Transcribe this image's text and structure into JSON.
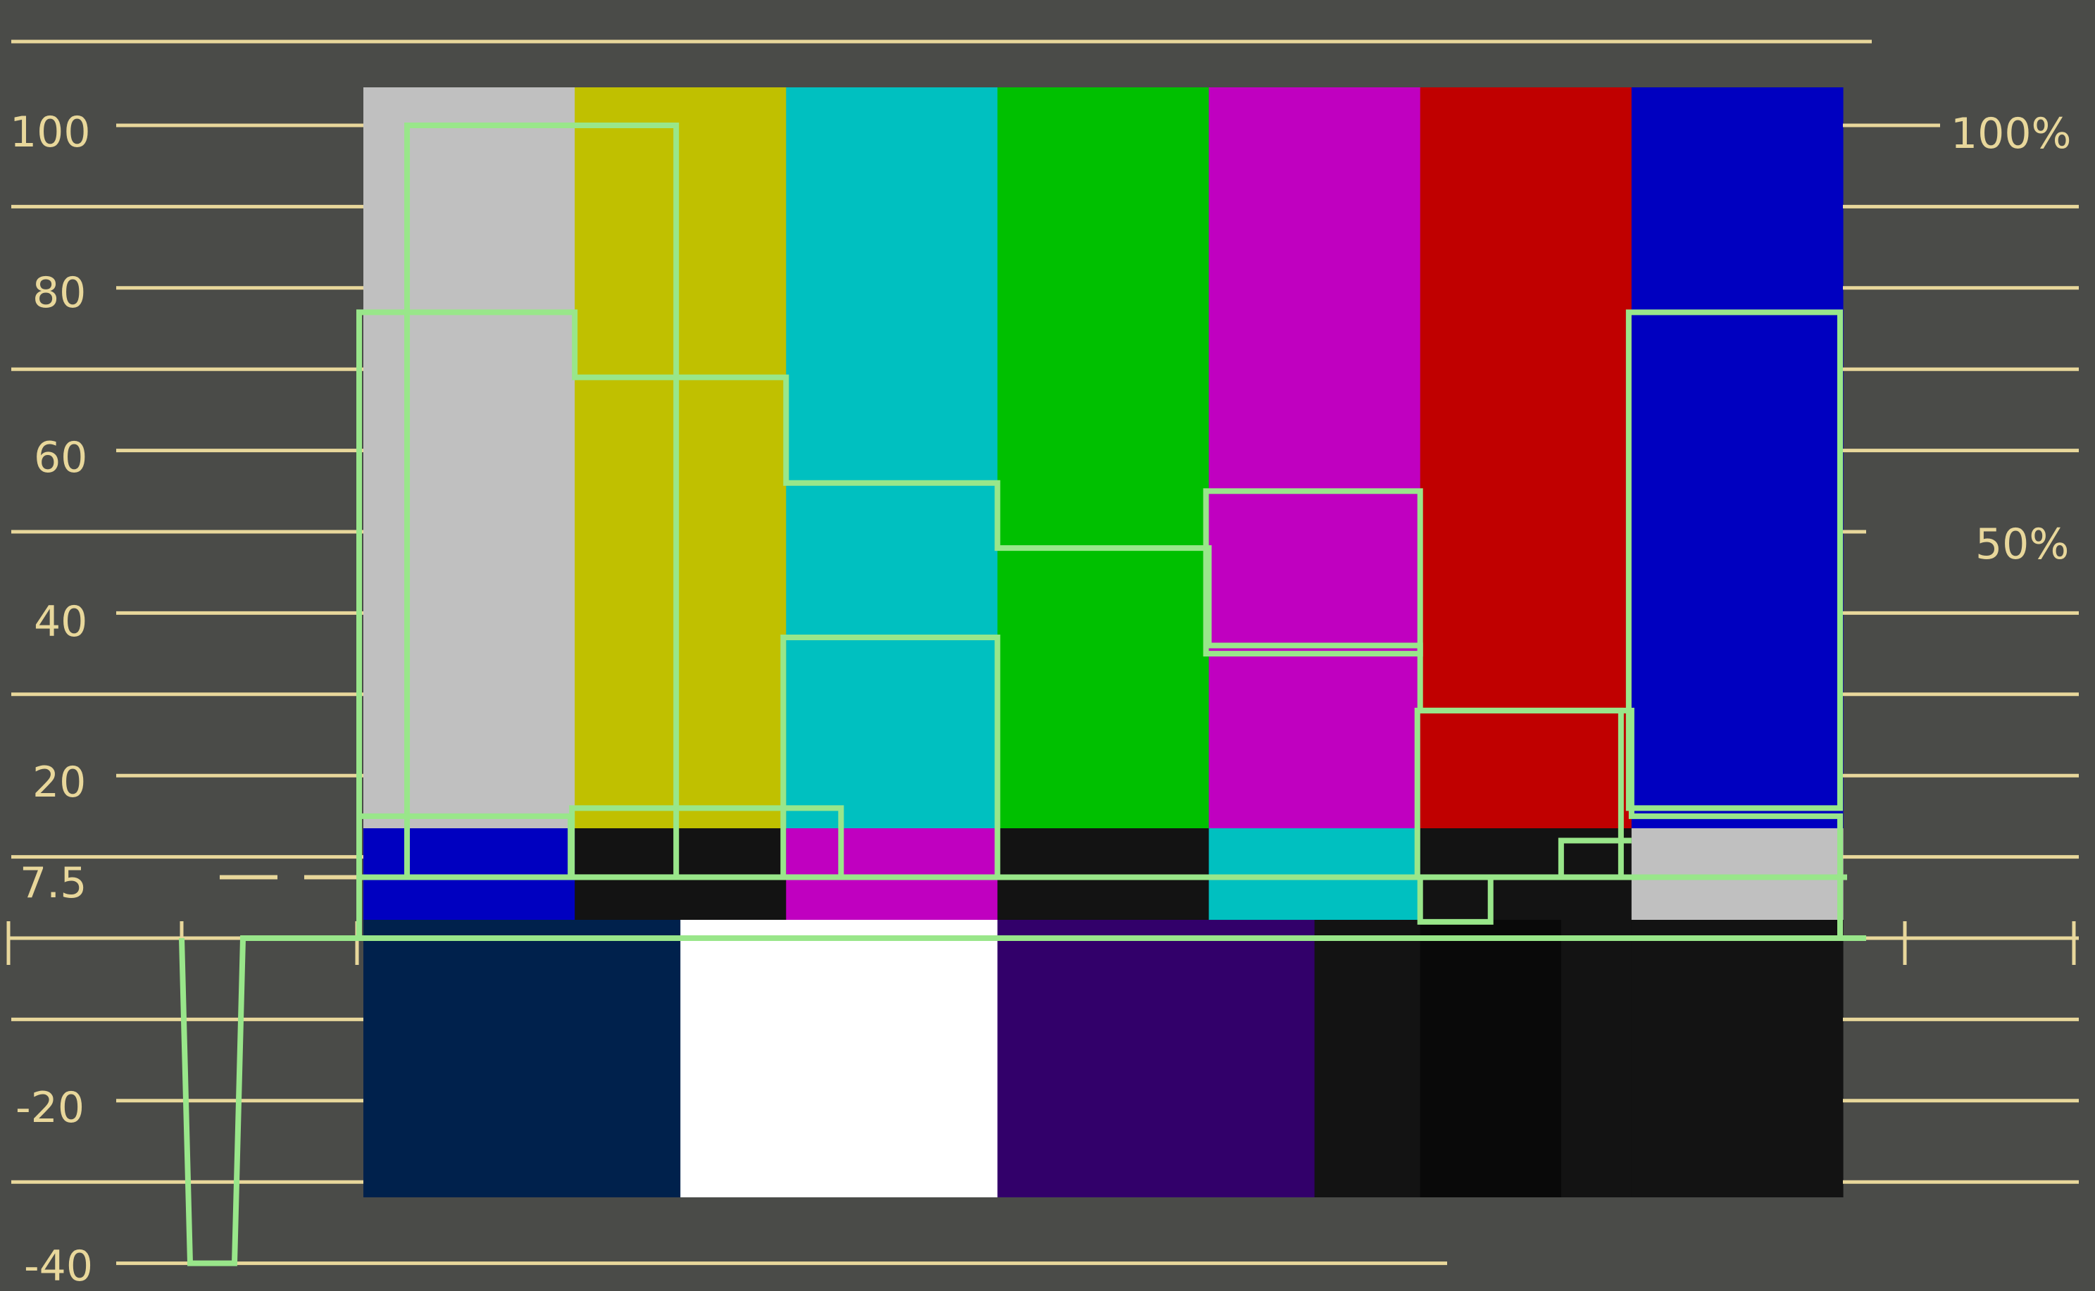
{
  "chart_data": {
    "type": "waveform",
    "title": "",
    "ylabel": "",
    "xlabel": "",
    "ylim": [
      -40,
      100
    ],
    "left_ticks": [
      {
        "label": "100",
        "value": 100
      },
      {
        "label": "80",
        "value": 80
      },
      {
        "label": "60",
        "value": 60
      },
      {
        "label": "40",
        "value": 40
      },
      {
        "label": "20",
        "value": 20
      },
      {
        "label": "7.5",
        "value": 7.5
      },
      {
        "label": "-20",
        "value": -20
      },
      {
        "label": "-40",
        "value": -40
      }
    ],
    "right_ticks": [
      {
        "label": "100%",
        "value": 100
      },
      {
        "label": "50%",
        "value": 50
      }
    ],
    "gridlines_ire": [
      100,
      90,
      80,
      70,
      60,
      50,
      40,
      30,
      20,
      10,
      -10,
      -20,
      -30,
      -40
    ],
    "pedestal_ire": 7.5,
    "top_bars": {
      "names": [
        "gray",
        "yellow",
        "cyan",
        "green",
        "magenta",
        "red",
        "blue"
      ],
      "colors": [
        "#c0c0c0",
        "#c0c000",
        "#00c0c0",
        "#00c000",
        "#c000c0",
        "#c00000",
        "#0000c0"
      ]
    },
    "middle_bars": {
      "names": [
        "blue",
        "black",
        "magenta",
        "black",
        "cyan",
        "black",
        "gray"
      ],
      "colors": [
        "#0000c0",
        "#131313",
        "#c000c0",
        "#131313",
        "#00c0c0",
        "#131313",
        "#c0c0c0"
      ]
    },
    "bottom_bars": {
      "names": [
        "-I",
        "white",
        "+Q",
        "black",
        "sub-black",
        "black",
        "super-black",
        "black"
      ],
      "colors": [
        "#00214c",
        "#ffffff",
        "#32006a",
        "#131313",
        "#090909",
        "#131313",
        "#1d1d1d",
        "#131313"
      ]
    },
    "trace_color": "#99e68a",
    "sync_tip_ire": -40,
    "luma_ire": [
      77,
      69,
      56,
      48,
      36,
      28,
      15
    ],
    "chroma_envelope_ire": [
      [
        16,
        7.5
      ],
      [
        7.5,
        100
      ],
      [
        37,
        7.5
      ],
      [
        55,
        35
      ],
      [
        28,
        7.5
      ],
      [
        77,
        16
      ]
    ],
    "mid_bar_ire": [
      15,
      7.5,
      37,
      7.5,
      7,
      12,
      77
    ],
    "colors": {
      "background": "#4a4b48",
      "graticule": "#e8d79b"
    }
  }
}
